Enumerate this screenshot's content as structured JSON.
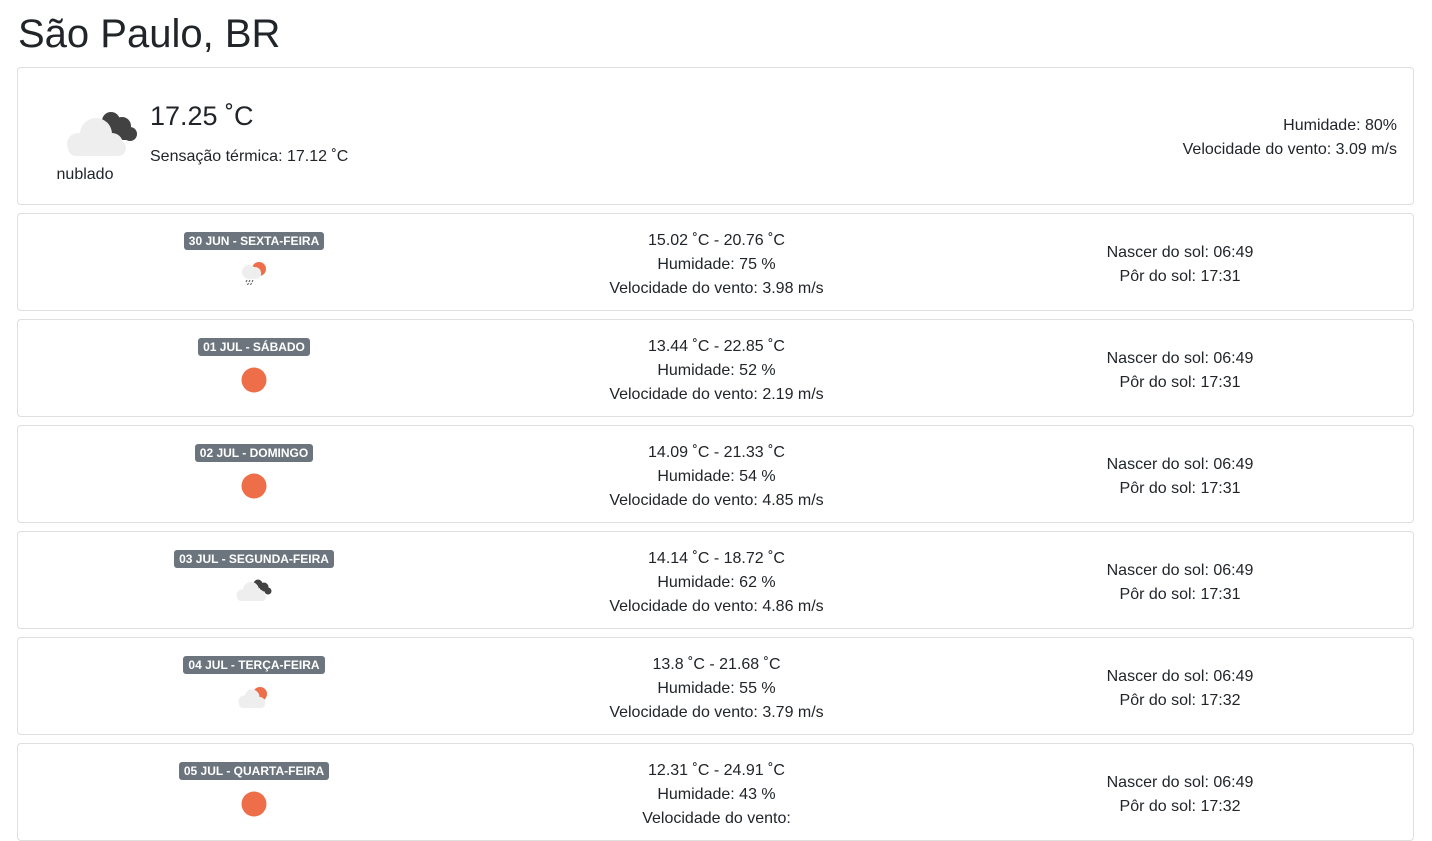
{
  "city": "São Paulo, BR",
  "current": {
    "icon": "cloudy-icon",
    "condition": "nublado",
    "temperature": "17.25 ˚C",
    "feels_like": "Sensação térmica: 17.12 ˚C",
    "humidity": "Humidade: 80%",
    "wind": "Velocidade do vento: 3.09 m/s"
  },
  "colors": {
    "sun": "#ee6e49",
    "dark_cloud": "#424242",
    "light_cloud": "#eeeeee",
    "badge": "#6c757d"
  },
  "forecast": [
    {
      "date": "30 JUN - SEXTA-FEIRA",
      "icon": "sun-rain-icon",
      "temps": "15.02 ˚C - 20.76 ˚C",
      "humidity": "Humidade: 75 %",
      "wind": "Velocidade do vento: 3.98 m/s",
      "sunrise": "Nascer do sol: 06:49",
      "sunset": "Pôr do sol: 17:31"
    },
    {
      "date": "01 JUL - SÁBADO",
      "icon": "sun-icon",
      "temps": "13.44 ˚C - 22.85 ˚C",
      "humidity": "Humidade: 52 %",
      "wind": "Velocidade do vento: 2.19 m/s",
      "sunrise": "Nascer do sol: 06:49",
      "sunset": "Pôr do sol: 17:31"
    },
    {
      "date": "02 JUL - DOMINGO",
      "icon": "sun-icon",
      "temps": "14.09 ˚C - 21.33 ˚C",
      "humidity": "Humidade: 54 %",
      "wind": "Velocidade do vento: 4.85 m/s",
      "sunrise": "Nascer do sol: 06:49",
      "sunset": "Pôr do sol: 17:31"
    },
    {
      "date": "03 JUL - SEGUNDA-FEIRA",
      "icon": "cloudy-icon",
      "temps": "14.14 ˚C - 18.72 ˚C",
      "humidity": "Humidade: 62 %",
      "wind": "Velocidade do vento: 4.86 m/s",
      "sunrise": "Nascer do sol: 06:49",
      "sunset": "Pôr do sol: 17:31"
    },
    {
      "date": "04 JUL - TERÇA-FEIRA",
      "icon": "partly-cloudy-icon",
      "temps": "13.8 ˚C - 21.68 ˚C",
      "humidity": "Humidade: 55 %",
      "wind": "Velocidade do vento: 3.79 m/s",
      "sunrise": "Nascer do sol: 06:49",
      "sunset": "Pôr do sol: 17:32"
    },
    {
      "date": "05 JUL - QUARTA-FEIRA",
      "icon": "sun-icon",
      "temps": "12.31 ˚C - 24.91 ˚C",
      "humidity": "Humidade: 43 %",
      "wind": "Velocidade do vento: ",
      "sunrise": "Nascer do sol: 06:49",
      "sunset": "Pôr do sol: 17:32"
    }
  ]
}
